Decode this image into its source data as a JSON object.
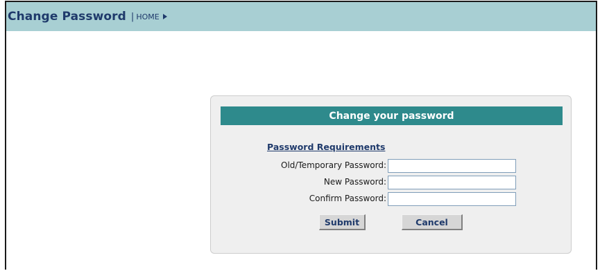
{
  "header": {
    "title": "Change Password",
    "separator": "|",
    "home_link": "HOME"
  },
  "panel": {
    "title": "Change your password",
    "requirements_link": "Password Requirements",
    "fields": [
      {
        "label": "Old/Temporary Password:",
        "value": "",
        "placeholder": ""
      },
      {
        "label": "New Password:",
        "value": "",
        "placeholder": ""
      },
      {
        "label": "Confirm Password:",
        "value": "",
        "placeholder": ""
      }
    ],
    "submit_label": "Submit",
    "cancel_label": "Cancel"
  },
  "icons": {
    "home_arrow": "triangle-right-icon"
  },
  "colors": {
    "header_bg": "#a8cfd3",
    "title_text": "#1f3a6b",
    "panel_header_bg": "#2e8a8c",
    "panel_bg": "#efefef",
    "button_bg": "#d6d6d6"
  }
}
